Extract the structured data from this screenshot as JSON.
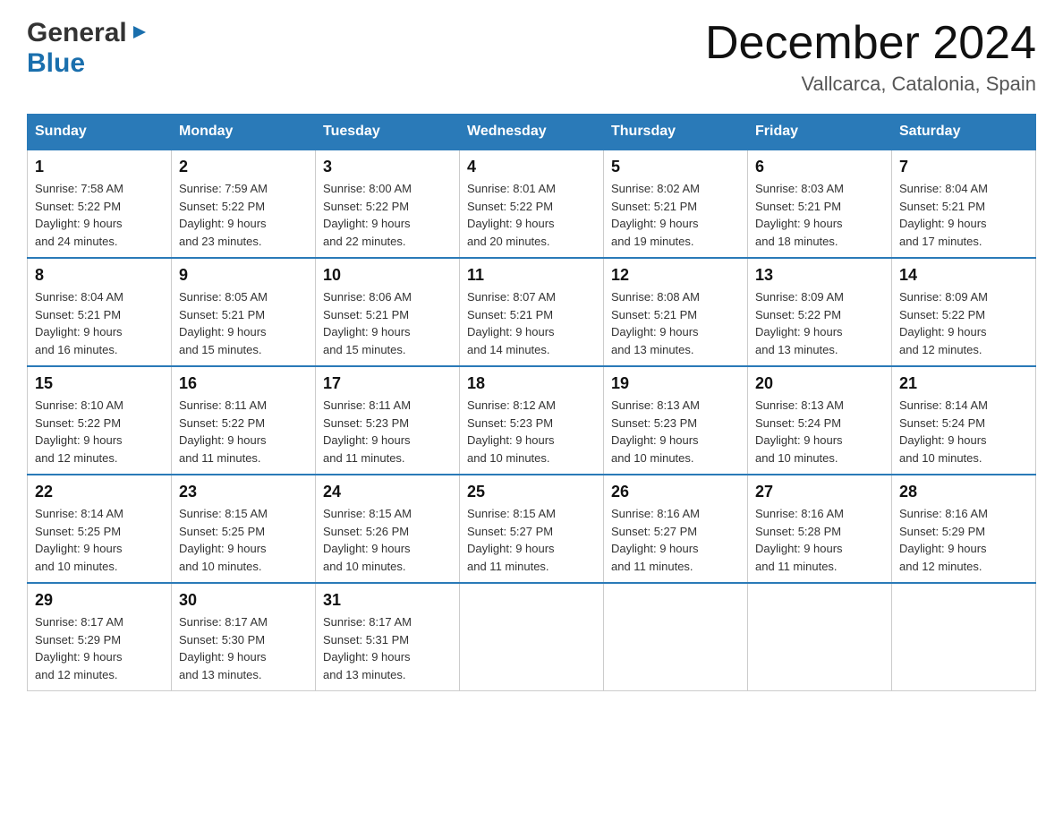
{
  "logo": {
    "general": "General",
    "blue": "Blue"
  },
  "header": {
    "month_year": "December 2024",
    "location": "Vallcarca, Catalonia, Spain"
  },
  "days_of_week": [
    "Sunday",
    "Monday",
    "Tuesday",
    "Wednesday",
    "Thursday",
    "Friday",
    "Saturday"
  ],
  "weeks": [
    [
      {
        "day": "1",
        "info": "Sunrise: 7:58 AM\nSunset: 5:22 PM\nDaylight: 9 hours\nand 24 minutes."
      },
      {
        "day": "2",
        "info": "Sunrise: 7:59 AM\nSunset: 5:22 PM\nDaylight: 9 hours\nand 23 minutes."
      },
      {
        "day": "3",
        "info": "Sunrise: 8:00 AM\nSunset: 5:22 PM\nDaylight: 9 hours\nand 22 minutes."
      },
      {
        "day": "4",
        "info": "Sunrise: 8:01 AM\nSunset: 5:22 PM\nDaylight: 9 hours\nand 20 minutes."
      },
      {
        "day": "5",
        "info": "Sunrise: 8:02 AM\nSunset: 5:21 PM\nDaylight: 9 hours\nand 19 minutes."
      },
      {
        "day": "6",
        "info": "Sunrise: 8:03 AM\nSunset: 5:21 PM\nDaylight: 9 hours\nand 18 minutes."
      },
      {
        "day": "7",
        "info": "Sunrise: 8:04 AM\nSunset: 5:21 PM\nDaylight: 9 hours\nand 17 minutes."
      }
    ],
    [
      {
        "day": "8",
        "info": "Sunrise: 8:04 AM\nSunset: 5:21 PM\nDaylight: 9 hours\nand 16 minutes."
      },
      {
        "day": "9",
        "info": "Sunrise: 8:05 AM\nSunset: 5:21 PM\nDaylight: 9 hours\nand 15 minutes."
      },
      {
        "day": "10",
        "info": "Sunrise: 8:06 AM\nSunset: 5:21 PM\nDaylight: 9 hours\nand 15 minutes."
      },
      {
        "day": "11",
        "info": "Sunrise: 8:07 AM\nSunset: 5:21 PM\nDaylight: 9 hours\nand 14 minutes."
      },
      {
        "day": "12",
        "info": "Sunrise: 8:08 AM\nSunset: 5:21 PM\nDaylight: 9 hours\nand 13 minutes."
      },
      {
        "day": "13",
        "info": "Sunrise: 8:09 AM\nSunset: 5:22 PM\nDaylight: 9 hours\nand 13 minutes."
      },
      {
        "day": "14",
        "info": "Sunrise: 8:09 AM\nSunset: 5:22 PM\nDaylight: 9 hours\nand 12 minutes."
      }
    ],
    [
      {
        "day": "15",
        "info": "Sunrise: 8:10 AM\nSunset: 5:22 PM\nDaylight: 9 hours\nand 12 minutes."
      },
      {
        "day": "16",
        "info": "Sunrise: 8:11 AM\nSunset: 5:22 PM\nDaylight: 9 hours\nand 11 minutes."
      },
      {
        "day": "17",
        "info": "Sunrise: 8:11 AM\nSunset: 5:23 PM\nDaylight: 9 hours\nand 11 minutes."
      },
      {
        "day": "18",
        "info": "Sunrise: 8:12 AM\nSunset: 5:23 PM\nDaylight: 9 hours\nand 10 minutes."
      },
      {
        "day": "19",
        "info": "Sunrise: 8:13 AM\nSunset: 5:23 PM\nDaylight: 9 hours\nand 10 minutes."
      },
      {
        "day": "20",
        "info": "Sunrise: 8:13 AM\nSunset: 5:24 PM\nDaylight: 9 hours\nand 10 minutes."
      },
      {
        "day": "21",
        "info": "Sunrise: 8:14 AM\nSunset: 5:24 PM\nDaylight: 9 hours\nand 10 minutes."
      }
    ],
    [
      {
        "day": "22",
        "info": "Sunrise: 8:14 AM\nSunset: 5:25 PM\nDaylight: 9 hours\nand 10 minutes."
      },
      {
        "day": "23",
        "info": "Sunrise: 8:15 AM\nSunset: 5:25 PM\nDaylight: 9 hours\nand 10 minutes."
      },
      {
        "day": "24",
        "info": "Sunrise: 8:15 AM\nSunset: 5:26 PM\nDaylight: 9 hours\nand 10 minutes."
      },
      {
        "day": "25",
        "info": "Sunrise: 8:15 AM\nSunset: 5:27 PM\nDaylight: 9 hours\nand 11 minutes."
      },
      {
        "day": "26",
        "info": "Sunrise: 8:16 AM\nSunset: 5:27 PM\nDaylight: 9 hours\nand 11 minutes."
      },
      {
        "day": "27",
        "info": "Sunrise: 8:16 AM\nSunset: 5:28 PM\nDaylight: 9 hours\nand 11 minutes."
      },
      {
        "day": "28",
        "info": "Sunrise: 8:16 AM\nSunset: 5:29 PM\nDaylight: 9 hours\nand 12 minutes."
      }
    ],
    [
      {
        "day": "29",
        "info": "Sunrise: 8:17 AM\nSunset: 5:29 PM\nDaylight: 9 hours\nand 12 minutes."
      },
      {
        "day": "30",
        "info": "Sunrise: 8:17 AM\nSunset: 5:30 PM\nDaylight: 9 hours\nand 13 minutes."
      },
      {
        "day": "31",
        "info": "Sunrise: 8:17 AM\nSunset: 5:31 PM\nDaylight: 9 hours\nand 13 minutes."
      },
      null,
      null,
      null,
      null
    ]
  ]
}
